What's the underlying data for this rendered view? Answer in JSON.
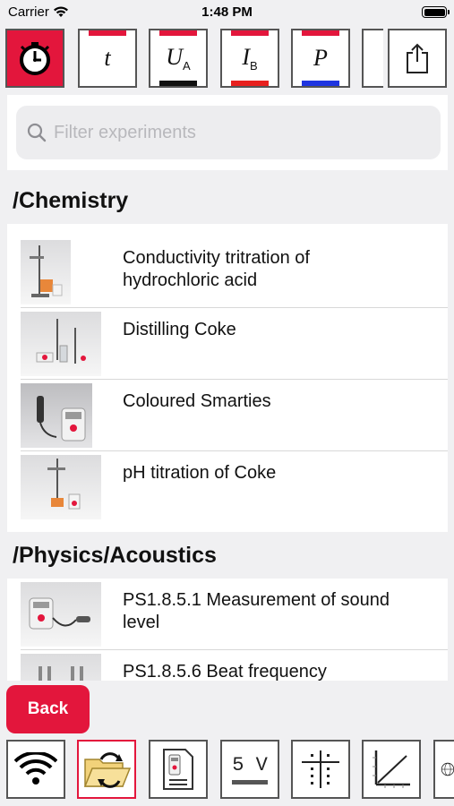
{
  "status_bar": {
    "carrier": "Carrier",
    "time": "1:48 PM"
  },
  "toolbar": {
    "items": [
      {
        "name": "timer-icon",
        "symbol": "",
        "sub": "",
        "bar_color": ""
      },
      {
        "name": "time-channel",
        "symbol": "t",
        "sub": "",
        "bar_color": ""
      },
      {
        "name": "voltage-channel",
        "symbol": "U",
        "sub": "A",
        "bar_color": "#111111"
      },
      {
        "name": "current-channel",
        "symbol": "I",
        "sub": "B",
        "bar_color": "#e8201e"
      },
      {
        "name": "power-channel",
        "symbol": "P",
        "sub": "",
        "bar_color": "#1f35e0"
      }
    ],
    "accent_color": "#e3163c"
  },
  "filter": {
    "placeholder": "Filter experiments",
    "value": ""
  },
  "sections": [
    {
      "header": "/Chemistry",
      "items": [
        {
          "title": "Conductivity tritration of hydrochloric acid",
          "thumb_icon": "titration-setup-image"
        },
        {
          "title": "Distilling Coke",
          "thumb_icon": "distilling-setup-image"
        },
        {
          "title": "Coloured Smarties",
          "thumb_icon": "sensor-device-image"
        },
        {
          "title": "pH titration of Coke",
          "thumb_icon": "ph-titration-image"
        }
      ]
    },
    {
      "header": "/Physics/Acoustics",
      "items": [
        {
          "title": "PS1.8.5.1 Measurement of sound level",
          "thumb_icon": "sound-sensor-image"
        },
        {
          "title": "PS1.8.5.6 Beat frequency",
          "thumb_icon": "tuning-forks-image"
        }
      ]
    }
  ],
  "back_button": {
    "label": "Back"
  },
  "bottom_bar": {
    "items": [
      {
        "name": "wifi-icon"
      },
      {
        "name": "open-folder-sync-icon"
      },
      {
        "name": "sensor-document-icon"
      },
      {
        "name": "voltage-source-button",
        "label": "5 V"
      },
      {
        "name": "table-grid-icon"
      },
      {
        "name": "graph-plot-icon"
      },
      {
        "name": "globe-icon"
      }
    ]
  }
}
